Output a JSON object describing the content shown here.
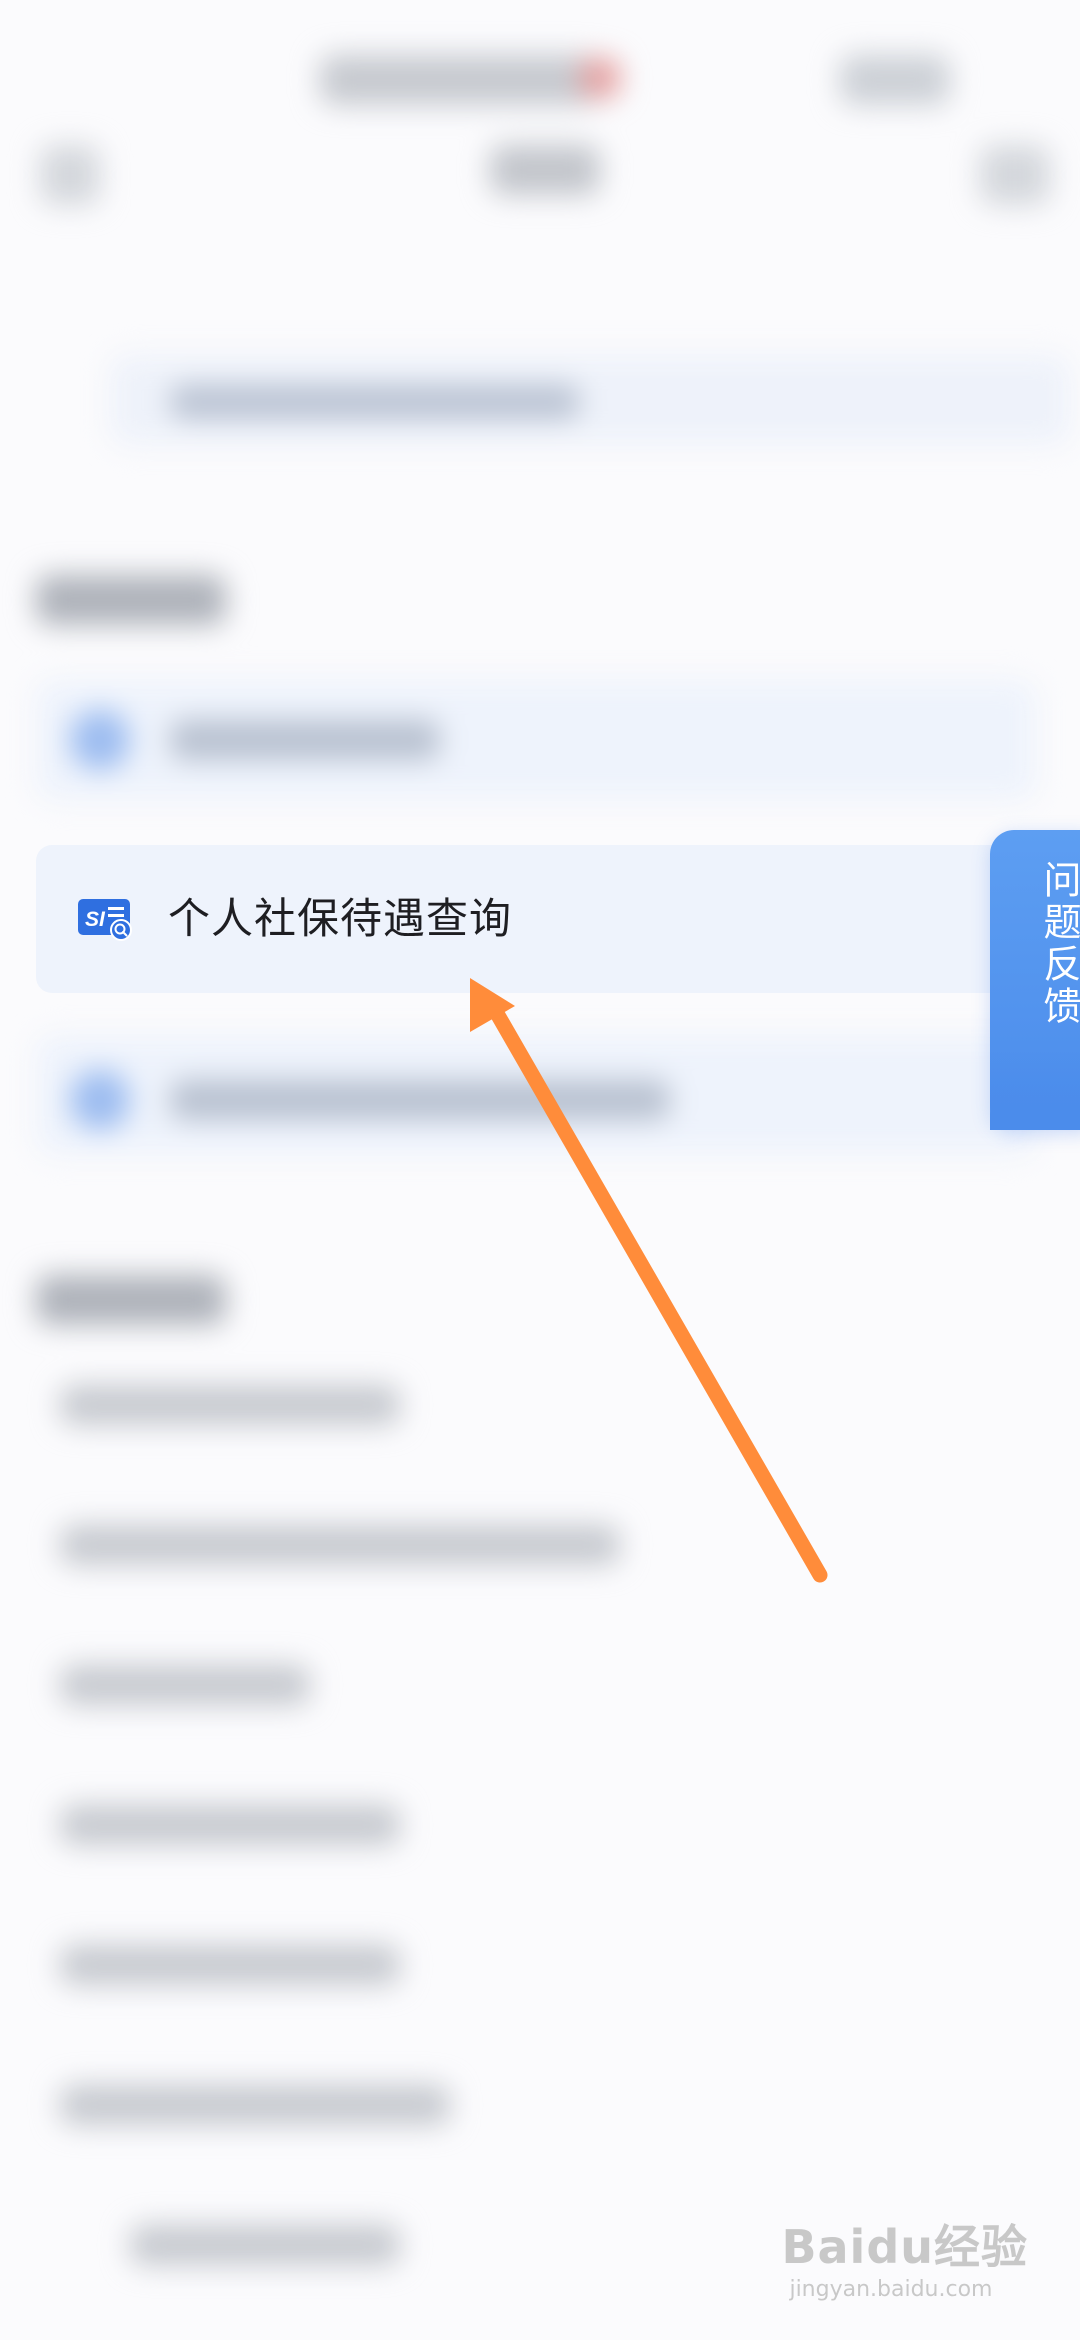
{
  "main_item": {
    "label": "个人社保待遇查询",
    "icon": "social-security-search-icon",
    "icon_text": "SI"
  },
  "feedback_tab": {
    "label": "问题反馈"
  },
  "annotation": {
    "arrow_color": "#ff8c3a"
  },
  "watermark": {
    "brand": "Baidu经验",
    "url": "jingyan.baidu.com"
  },
  "colors": {
    "accent": "#4b8ceb",
    "item_background": "#eef3fc",
    "icon_blue": "#2f6fe0"
  }
}
